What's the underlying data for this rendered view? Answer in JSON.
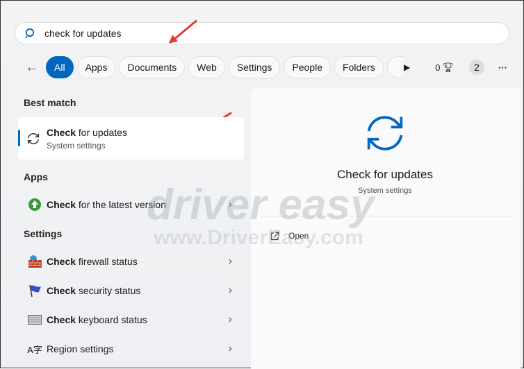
{
  "search": {
    "value": "check for updates",
    "icon": "search-icon"
  },
  "filters": {
    "back": "←",
    "chips": [
      "All",
      "Apps",
      "Documents",
      "Web",
      "Settings",
      "People",
      "Folders"
    ],
    "more_arrow": "▶",
    "points": "0",
    "trophy_icon": "trophy-icon",
    "badge": "2",
    "menu": "···"
  },
  "sections": {
    "best_match": "Best match",
    "apps": "Apps",
    "settings": "Settings"
  },
  "best": {
    "bold": "Check",
    "rest": " for updates",
    "sub": "System settings",
    "icon": "refresh-icon"
  },
  "apps": [
    {
      "bold": "Check",
      "rest": " for the latest version",
      "icon": "globe-update-icon"
    }
  ],
  "settings": [
    {
      "bold": "Check",
      "rest": " firewall status",
      "icon": "firewall-icon"
    },
    {
      "bold": "Check",
      "rest": " security status",
      "icon": "flag-icon"
    },
    {
      "bold": "Check",
      "rest": " keyboard status",
      "icon": "keyboard-icon"
    },
    {
      "bold": "",
      "rest": "Region settings",
      "icon": "region-icon"
    }
  ],
  "detail": {
    "title": "Check for updates",
    "sub": "System settings",
    "open": "Open",
    "accent": "#0067c0"
  },
  "watermark": {
    "line1": "driver easy",
    "line2": "www.DriverEasy.com"
  }
}
